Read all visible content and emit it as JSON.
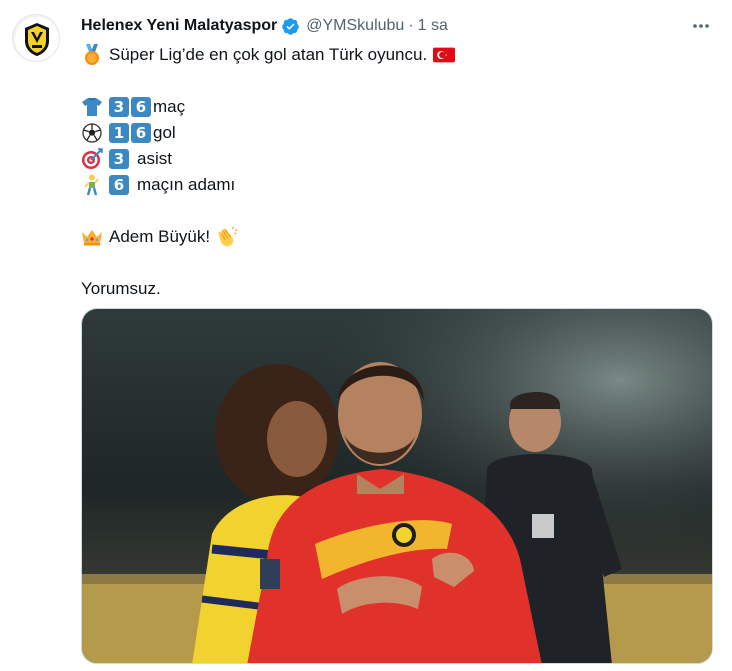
{
  "tweet": {
    "author_name": "Helenex Yeni Malatyaspor",
    "handle": "@YMSkulubu",
    "separator": "·",
    "time": "1 sa",
    "line1": "Süper Lig’de en çok gol atan Türk oyuncu.",
    "stat_mac_digits": [
      "3",
      "6"
    ],
    "stat_mac_label": "maç",
    "stat_gol_digits": [
      "1",
      "6"
    ],
    "stat_gol_label": "gol",
    "stat_asist_digits": [
      "3"
    ],
    "stat_asist_label": "asist",
    "stat_adam_digits": [
      "6"
    ],
    "stat_adam_label": "maçın adamı",
    "line_crown": "Adem Büyük!",
    "line_last": "Yorumsuz."
  },
  "colors": {
    "verified": "#1d9bf0",
    "keycap": "#3b88c3",
    "jersey": "#e0322b",
    "rival": "#f2d22e"
  },
  "icons": [
    "verified-badge-icon",
    "more-options-icon",
    "medal-icon",
    "jersey-icon",
    "soccer-ball-icon",
    "target-icon",
    "person-icon",
    "crown-icon",
    "clapping-hands-icon",
    "turkey-flag-icon"
  ]
}
